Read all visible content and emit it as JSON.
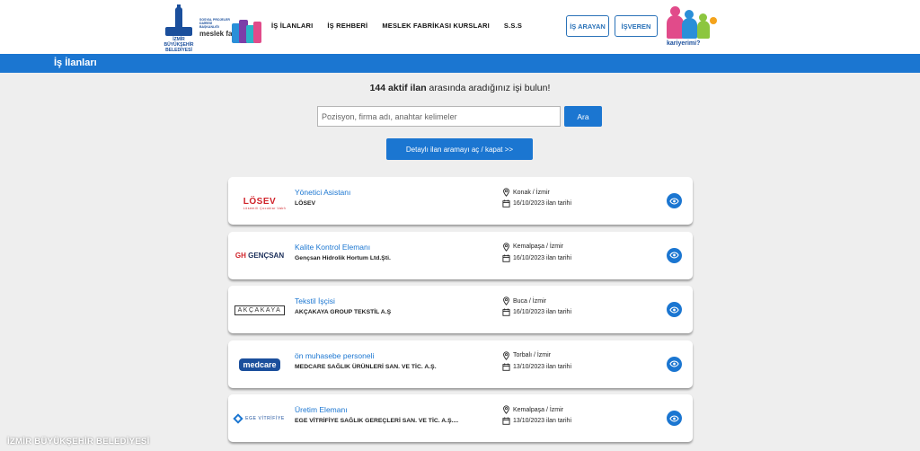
{
  "header": {
    "izmir_logo_text": "İZMİR BÜYÜKŞEHİR BELEDİYESİ",
    "mf_logo_small": "SOSYAL PROJELER DAİRESİ BAŞKANLIĞI",
    "mf_logo_big": "meslek fabrikası",
    "nav": [
      {
        "label": "İŞ İLANLARI"
      },
      {
        "label": "İŞ REHBERİ"
      },
      {
        "label": "MESLEK FABRİKASI KURSLARI"
      },
      {
        "label": "S.S.S"
      }
    ],
    "seeker_label": "İŞ ARAYAN",
    "employer_label": "İŞVEREN",
    "kg_logo_text": "kariyerimi?"
  },
  "titlebar": {
    "title": "İş İlanları"
  },
  "hero": {
    "count": "144 aktif ilan",
    "headline_rest": " arasında aradığınız işi bulun!",
    "search_placeholder": "Pozisyon, firma adı, anahtar kelimeler",
    "search_button": "Ara",
    "detail_button": "Detaylı ilan aramayı aç / kapat >>"
  },
  "listings": [
    {
      "logo": "LÖSEV",
      "logo_sub": "Lösemili Çocuklar Vakfı",
      "title": "Yönetici Asistanı",
      "company": "LÖSEV",
      "location": "Konak / İzmir",
      "date": "16/10/2023 ilan tarihi"
    },
    {
      "logo": "GENÇSAN",
      "logo_prefix": "GH",
      "title": "Kalite Kontrol Elemanı",
      "company": "Gençsan Hidrolik Hortum Ltd.Şti.",
      "location": "Kemalpaşa / İzmir",
      "date": "16/10/2023 ilan tarihi"
    },
    {
      "logo": "AKÇAKAYA",
      "title": "Tekstil İşçisi",
      "company": "AKÇAKAYA GROUP TEKSTİL A.Ş",
      "location": "Buca / İzmir",
      "date": "16/10/2023 ilan tarihi"
    },
    {
      "logo": "medcare",
      "title": "ön muhasebe personeli",
      "company": "MEDCARE SAĞLIK ÜRÜNLERİ SAN. VE TİC. A.Ş.",
      "location": "Torbalı / İzmir",
      "date": "13/10/2023 ilan tarihi"
    },
    {
      "logo": "EGE VİTRİFİYE",
      "title": "Üretim Elemanı",
      "company": "EGE VİTRİFİYE SAĞLIK GEREÇLERİ SAN. VE TİC. A.Ş....",
      "location": "Kemalpaşa / İzmir",
      "date": "13/10/2023 ilan tarihi"
    }
  ],
  "watermark": "İZMİR BÜYÜKŞEHİR BELEDİYESİ",
  "colors": {
    "primary": "#1b76d1",
    "navy": "#1b4f9c",
    "background": "#eeeeee"
  },
  "icons": {
    "location": "map-pin-icon",
    "date": "calendar-icon",
    "view": "eye-icon"
  }
}
